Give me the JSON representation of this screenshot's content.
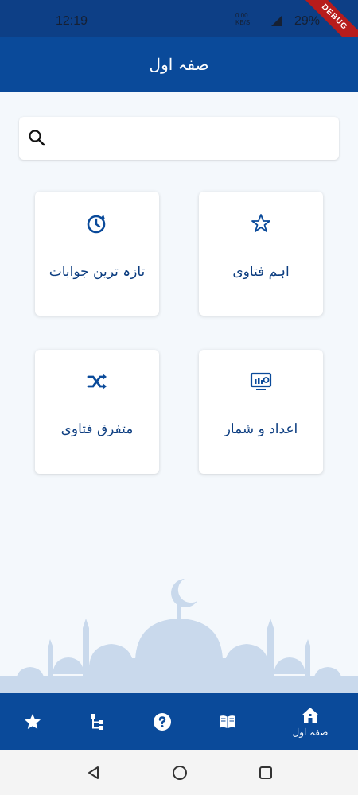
{
  "status_bar": {
    "time": "12:19",
    "net_line1": "0.00",
    "net_line2": "KB/S",
    "battery": "29%",
    "debug_label": "DEBUG"
  },
  "app_bar": {
    "title": "صفہ اول"
  },
  "search": {
    "placeholder": "",
    "value": ""
  },
  "cards": [
    {
      "label": "اہم فتاوی",
      "icon": "star-icon"
    },
    {
      "label": "تازہ ترین جوابات",
      "icon": "history-icon"
    },
    {
      "label": "اعداد و شمار",
      "icon": "monitor-analytics-icon"
    },
    {
      "label": "متفرق فتاوی",
      "icon": "shuffle-icon"
    }
  ],
  "bottom_nav": {
    "items": [
      {
        "icon": "star-icon",
        "label": ""
      },
      {
        "icon": "tree-icon",
        "label": ""
      },
      {
        "icon": "help-icon",
        "label": ""
      },
      {
        "icon": "book-icon",
        "label": ""
      },
      {
        "icon": "home-icon",
        "label": "صفہ اول"
      }
    ]
  },
  "colors": {
    "primary": "#0a4a9a",
    "status_bar": "#0d3f86",
    "background": "#f4f8fc",
    "card_text": "#0c3d80",
    "mosque": "#c9d9ec"
  }
}
